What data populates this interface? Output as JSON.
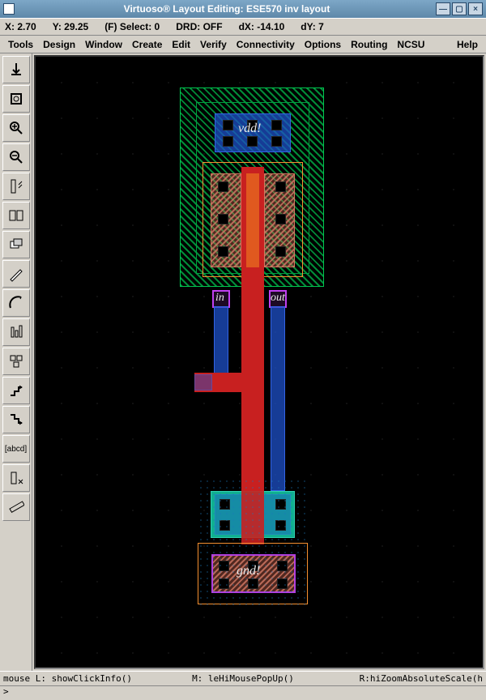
{
  "window": {
    "title": "Virtuoso® Layout Editing: ESE570 inv layout",
    "min": "—",
    "max": "▢",
    "close": "×"
  },
  "coord": {
    "x_label": "X:",
    "x_val": "2.70",
    "y_label": "Y:",
    "y_val": "29.25",
    "select_label": "(F) Select:",
    "select_val": "0",
    "drd_label": "DRD:",
    "drd_val": "OFF",
    "dx_label": "dX:",
    "dx_val": "-14.10",
    "dy_label": "dY:",
    "dy_val": "7"
  },
  "menu": {
    "tools": "Tools",
    "design": "Design",
    "window": "Window",
    "create": "Create",
    "edit": "Edit",
    "verify": "Verify",
    "connectivity": "Connectivity",
    "options": "Options",
    "routing": "Routing",
    "ncsu": "NCSU",
    "help": "Help"
  },
  "labels": {
    "vdd": "vdd!",
    "gnd": "gnd!",
    "in": "in",
    "out": "out"
  },
  "mousebar": {
    "left": "mouse L: showClickInfo()",
    "mid": "M: leHiMousePopUp()",
    "right": "R:hiZoomAbsoluteScale(h"
  },
  "prompt": ">"
}
